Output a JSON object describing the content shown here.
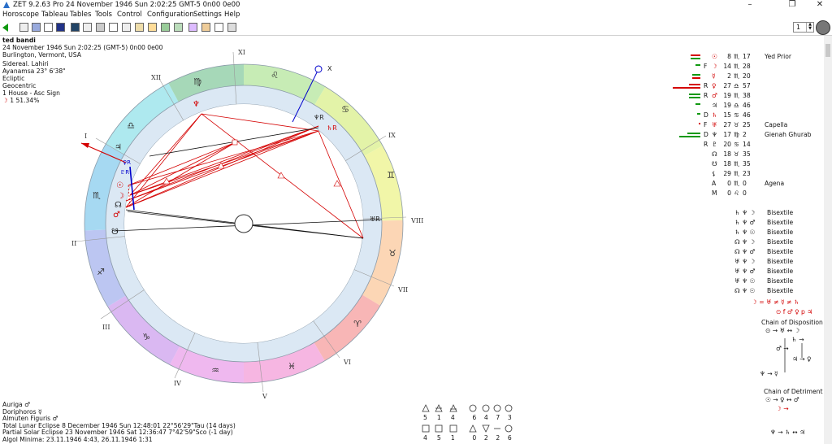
{
  "window": {
    "title": "ZET 9.2.63 Pro   24 November 1946  Sun   2:02:25 GMT-5 0n00  0e00",
    "controls": [
      "–",
      "❐",
      "✕"
    ]
  },
  "menu": [
    "Horoscope",
    "Tableau",
    "Tables",
    "Tools",
    "Control",
    "Configuration",
    "Settings",
    "Help"
  ],
  "toolbar": {
    "page_value": "1"
  },
  "info": {
    "name": "ted bandi",
    "date_line": "24 November 1946  Sun   2:02:25 (GMT-5) 0n00  0e00",
    "place": "Burlington, Vermont, USA",
    "zodiac": "Sidereal. Lahiri",
    "ayanamsa": "Ayanamsa 23° 6'38\"",
    "coords": "Ecliptic",
    "centric": "Geocentric",
    "house_system": "1 House - Asc Sign",
    "moon_phase_glyph": "☽",
    "moon_phase": "1 51.34%"
  },
  "houses": [
    "I",
    "II",
    "III",
    "IV",
    "V",
    "VI",
    "VII",
    "VIII",
    "IX",
    "X",
    "XI",
    "XII"
  ],
  "sign_glyphs": [
    "♎",
    "♍",
    "♌",
    "♋",
    "♊",
    "♉",
    "♈",
    "♓",
    "♒",
    "♑",
    "♐",
    "♏"
  ],
  "wheel_planets": [
    "♃",
    "♀R",
    "♇R",
    "☉",
    "☽",
    "☊",
    "♂",
    "☋",
    "♆",
    "♆R",
    "♄R",
    "♅R"
  ],
  "midheaven_label": "X",
  "positions": [
    {
      "glyph": "☉",
      "flag": "",
      "deg": "8",
      "sign": "♏",
      "min": "17",
      "star": "Yed Prior"
    },
    {
      "glyph": "☽",
      "flag": "F",
      "deg": "14",
      "sign": "♏",
      "min": "28",
      "star": ""
    },
    {
      "glyph": "☿",
      "flag": "",
      "deg": "2",
      "sign": "♏",
      "min": "20",
      "star": ""
    },
    {
      "glyph": "♀",
      "flag": "R",
      "deg": "27",
      "sign": "♎",
      "min": "57",
      "star": ""
    },
    {
      "glyph": "♂",
      "flag": "R",
      "deg": "19",
      "sign": "♏",
      "min": "38",
      "star": ""
    },
    {
      "glyph": "♃",
      "flag": "",
      "deg": "19",
      "sign": "♎",
      "min": "46",
      "star": ""
    },
    {
      "glyph": "♄",
      "flag": "D",
      "deg": "15",
      "sign": "♋",
      "min": "46",
      "star": ""
    },
    {
      "glyph": "♅",
      "flag": "F",
      "deg": "27",
      "sign": "♉",
      "min": "25",
      "star": "Capella"
    },
    {
      "glyph": "♆",
      "flag": "D",
      "deg": "17",
      "sign": "♍",
      "min": "2",
      "star": "Gienah Ghurab"
    },
    {
      "glyph": "♇",
      "flag": "R",
      "deg": "20",
      "sign": "♋",
      "min": "14",
      "star": ""
    },
    {
      "glyph": "☊",
      "flag": "",
      "deg": "18",
      "sign": "♉",
      "min": "35",
      "star": ""
    },
    {
      "glyph": "☋",
      "flag": "",
      "deg": "18",
      "sign": "♏",
      "min": "35",
      "star": ""
    },
    {
      "glyph": "⚸",
      "flag": "",
      "deg": "29",
      "sign": "♏",
      "min": "23",
      "star": ""
    },
    {
      "glyph": "A",
      "flag": "",
      "deg": "0",
      "sign": "♏",
      "min": "0",
      "star": "Agena"
    },
    {
      "glyph": "M",
      "flag": "",
      "deg": "0",
      "sign": "♌",
      "min": "0",
      "star": ""
    }
  ],
  "bisextiles": [
    {
      "glyphs": "♄ ♆ ☽",
      "label": "Bisextile"
    },
    {
      "glyphs": "♄ ♆ ♂",
      "label": "Bisextile"
    },
    {
      "glyphs": "♄ ♆ ☉",
      "label": "Bisextile"
    },
    {
      "glyphs": "☊ ♆ ☽",
      "label": "Bisextile"
    },
    {
      "glyphs": "☊ ♆ ♂",
      "label": "Bisextile"
    },
    {
      "glyphs": "♅ ♆ ☽",
      "label": "Bisextile"
    },
    {
      "glyphs": "♅ ♆ ♂",
      "label": "Bisextile"
    },
    {
      "glyphs": "♅ ♆ ☉",
      "label": "Bisextile"
    },
    {
      "glyphs": "☊ ♆ ☉",
      "label": "Bisextile"
    }
  ],
  "receptions": {
    "line1": "☽ = ♅ ≠ ☿ ≠ ♄",
    "line2": "⊙ f ♂ ♀ p ♃"
  },
  "disposition": {
    "title": "Chain of Disposition",
    "head": "⊙ → ♅ ↔ ☽",
    "r1": "♄ →",
    "r2": "♂ →",
    "r3": "♃ → ♀",
    "r4": "♆ → ☿"
  },
  "detriment": {
    "title": "Chain of Detriment",
    "head": "☉ → ♀ ↔ ♂",
    "r1": "☽ →",
    "r2": "♆ → ♄ ↔ ♃"
  },
  "bottom_left": [
    "Auriga  ♂",
    "Doriphoros  ☿",
    "Almuten Figuris  ♂",
    "Total Lunar Eclipse 8 December 1946 Sun 12:48:01 22°56'29\"Tau (14 days)",
    "Partial Solar Eclipse 23 November 1946 Sat 12:36:47  7°42'59\"Sco (-1 day)",
    "Algol Minima: 23.11.1946  4:43,  26.11.1946  1:31"
  ],
  "counts_top": [
    "5",
    "1",
    "4",
    "6",
    "4",
    "7",
    "3"
  ],
  "counts_bottom": [
    "4",
    "5",
    "1",
    "0",
    "2",
    "2",
    "6"
  ],
  "colors": {
    "aspect_red": "#d40000",
    "aspect_black": "#111111",
    "aspect_blue": "#0000cc",
    "ring_light": "#dbe8f4"
  }
}
